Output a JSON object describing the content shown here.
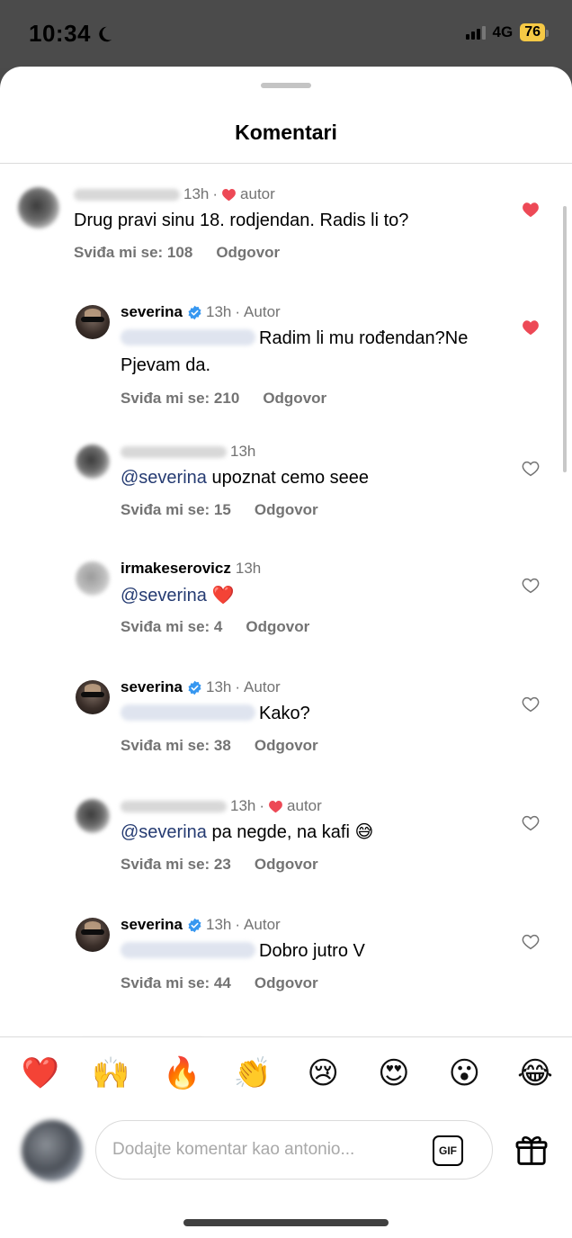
{
  "status": {
    "time": "10:34",
    "network": "4G",
    "battery": "76"
  },
  "header": {
    "title": "Komentari"
  },
  "comments": [
    {
      "time": "13h",
      "tag": "autor",
      "text": "Drug pravi sinu 18. rodjendan. Radis li to?",
      "likes": "Sviđa mi se: 108",
      "reply": "Odgovor",
      "liked": true
    },
    {
      "username": "severina",
      "time": "13h",
      "tag": "Autor",
      "text_line1": "Radim li mu rođendan?Ne",
      "text_line2": "Pjevam da.",
      "likes": "Sviđa mi se: 210",
      "reply": "Odgovor",
      "liked": true
    },
    {
      "time": "13h",
      "mention": "@severina",
      "text": "upoznat cemo seee",
      "likes": "Sviđa mi se: 15",
      "reply": "Odgovor",
      "liked": false
    },
    {
      "username": "irmakeserovicz",
      "time": "13h",
      "mention": "@severina",
      "text": "❤️",
      "likes": "Sviđa mi se: 4",
      "reply": "Odgovor",
      "liked": false
    },
    {
      "username": "severina",
      "time": "13h",
      "tag": "Autor",
      "text": "Kako?",
      "likes": "Sviđa mi se: 38",
      "reply": "Odgovor",
      "liked": false
    },
    {
      "time": "13h",
      "tag": "autor",
      "mention": "@severina",
      "text": "pa negde, na kafi 😅",
      "likes": "Sviđa mi se: 23",
      "reply": "Odgovor",
      "liked": false
    },
    {
      "username": "severina",
      "time": "13h",
      "tag": "Autor",
      "text": "Dobro jutro V",
      "likes": "Sviđa mi se: 44",
      "reply": "Odgovor",
      "liked": false
    }
  ],
  "emoji_bar": [
    "❤️",
    "🙌",
    "🔥",
    "👏",
    "😢",
    "😍",
    "😮",
    "😂"
  ],
  "composer": {
    "placeholder": "Dodajte komentar kao antonio...",
    "gif_label": "GIF"
  },
  "colors": {
    "accent_red": "#ed4956",
    "link_blue": "#253b72",
    "verified_blue": "#3797f0",
    "battery": "#f6c945"
  }
}
